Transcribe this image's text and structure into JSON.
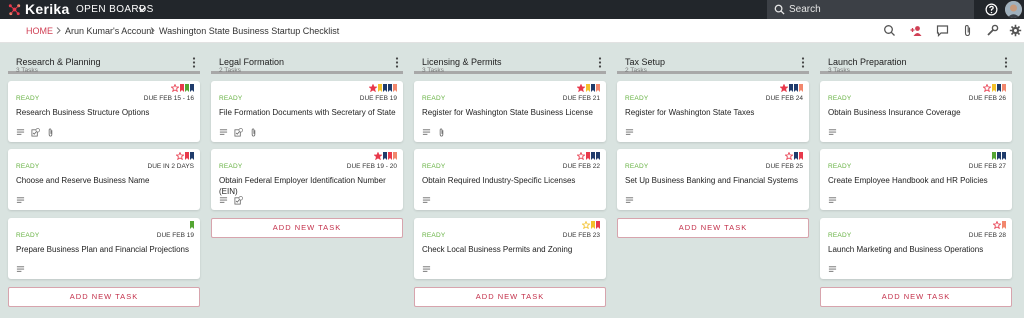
{
  "app": {
    "logo_text": "Kerika",
    "menu_label": "OPEN BOARDS"
  },
  "search": {
    "placeholder": "Search"
  },
  "breadcrumb": {
    "home": "HOME",
    "account": "Arun Kumar's Account",
    "board": "Washington State Business Startup Checklist"
  },
  "add_task_label": "ADD NEW TASK",
  "colors": {
    "red": "#e8394b",
    "yellow": "#f4c12a",
    "green": "#54a632",
    "navy": "#1f3b6b",
    "salmon": "#f2876d",
    "accent": "#d03f54",
    "ready": "#65b140"
  },
  "columns": [
    {
      "title": "Research & Planning",
      "count": "3 Tasks",
      "cards": [
        {
          "status": "READY",
          "due": "DUE FEB 15 - 16",
          "title": "Research Business Structure Options",
          "star": "outline",
          "flags": [
            "red",
            "green",
            "navy"
          ],
          "meta": [
            "description",
            "checklist",
            "attachment"
          ]
        },
        {
          "status": "READY",
          "due": "DUE IN 2 DAYS",
          "title": "Choose and Reserve Business Name",
          "star": "outline",
          "flags": [
            "red",
            "navy"
          ],
          "meta": [
            "description"
          ]
        },
        {
          "status": "READY",
          "due": "DUE FEB 19",
          "title": "Prepare Business Plan and Financial Projections",
          "star": "",
          "flags": [
            "green"
          ],
          "meta": [
            "description"
          ]
        }
      ]
    },
    {
      "title": "Legal Formation",
      "count": "2 Tasks",
      "cards": [
        {
          "status": "READY",
          "due": "DUE FEB 19",
          "title": "File Formation Documents with Secretary of State",
          "star": "filled",
          "flags": [
            "yellow",
            "navy",
            "navy",
            "salmon"
          ],
          "meta": [
            "description",
            "checklist",
            "attachment"
          ]
        },
        {
          "status": "READY",
          "due": "DUE FEB 19 - 20",
          "title": "Obtain Federal Employer Identification Number (EIN)",
          "star": "filled",
          "flags": [
            "navy",
            "red",
            "salmon"
          ],
          "meta": [
            "description",
            "checklist"
          ]
        }
      ]
    },
    {
      "title": "Licensing & Permits",
      "count": "3 Tasks",
      "cards": [
        {
          "status": "READY",
          "due": "DUE FEB 21",
          "title": "Register for Washington State Business License",
          "star": "filled",
          "flags": [
            "yellow",
            "navy",
            "salmon"
          ],
          "meta": [
            "description",
            "attachment"
          ]
        },
        {
          "status": "READY",
          "due": "DUE FEB 22",
          "title": "Obtain Required Industry-Specific Licenses",
          "star": "outline",
          "flags": [
            "red",
            "navy",
            "navy"
          ],
          "meta": [
            "description"
          ]
        },
        {
          "status": "READY",
          "due": "DUE FEB 23",
          "title": "Check Local Business Permits and Zoning",
          "star": "outline-yellow",
          "flags": [
            "yellow",
            "red"
          ],
          "meta": [
            "description"
          ]
        }
      ]
    },
    {
      "title": "Tax Setup",
      "count": "2 Tasks",
      "cards": [
        {
          "status": "READY",
          "due": "DUE FEB 24",
          "title": "Register for Washington State Taxes",
          "star": "filled",
          "flags": [
            "navy",
            "navy",
            "salmon"
          ],
          "meta": [
            "description"
          ]
        },
        {
          "status": "READY",
          "due": "DUE FEB 25",
          "title": "Set Up Business Banking and Financial Systems",
          "star": "outline",
          "flags": [
            "navy",
            "red"
          ],
          "meta": [
            "description"
          ]
        }
      ]
    },
    {
      "title": "Launch Preparation",
      "count": "3 Tasks",
      "cards": [
        {
          "status": "READY",
          "due": "DUE FEB 26",
          "title": "Obtain Business Insurance Coverage",
          "star": "outline",
          "flags": [
            "yellow",
            "navy",
            "salmon"
          ],
          "meta": [
            "description"
          ]
        },
        {
          "status": "READY",
          "due": "DUE FEB 27",
          "title": "Create Employee Handbook and HR Policies",
          "star": "",
          "flags": [
            "green",
            "navy",
            "navy"
          ],
          "meta": [
            "description"
          ]
        },
        {
          "status": "READY",
          "due": "DUE FEB 28",
          "title": "Launch Marketing and Business Operations",
          "star": "outline",
          "flags": [
            "salmon"
          ],
          "meta": [
            "description"
          ]
        }
      ]
    }
  ]
}
